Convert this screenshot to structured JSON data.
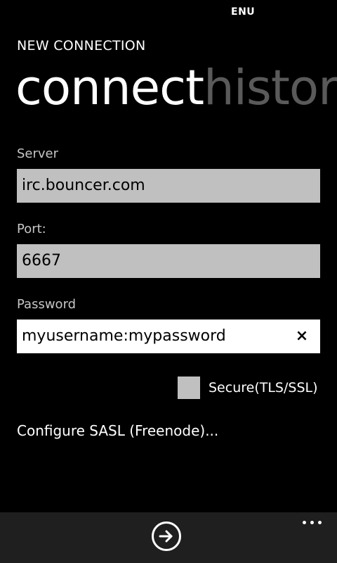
{
  "status_bar": {
    "language": "ENU"
  },
  "app": {
    "title": "NEW CONNECTION"
  },
  "pivot": {
    "items": [
      {
        "label": "connect",
        "active": true
      },
      {
        "label": "history",
        "active": false
      }
    ]
  },
  "form": {
    "server": {
      "label": "Server",
      "value": "irc.bouncer.com"
    },
    "port": {
      "label": "Port:",
      "value": "6667"
    },
    "password": {
      "label": "Password",
      "value": "myusername:mypassword",
      "clear_icon": "×"
    },
    "secure": {
      "label": "Secure(TLS/SSL)",
      "checked": false
    },
    "sasl_link": "Configure SASL (Freenode)..."
  },
  "app_bar": {
    "primary_icon": "arrow-right-circle-icon",
    "more_icon": "ellipsis-icon"
  },
  "colors": {
    "background": "#000000",
    "textbox": "#c0c0c0",
    "textbox_focused": "#ffffff",
    "inactive_pivot": "#5a5a5a",
    "app_bar": "#1f1f1f"
  }
}
